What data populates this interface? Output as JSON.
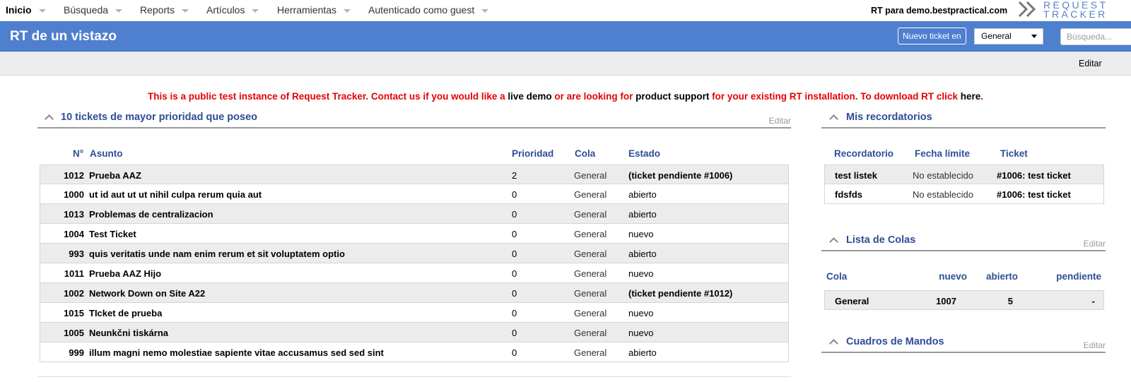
{
  "nav": {
    "items": [
      {
        "label": "Inicio",
        "active": true
      },
      {
        "label": "Búsqueda"
      },
      {
        "label": "Reports"
      },
      {
        "label": "Artículos"
      },
      {
        "label": "Herramientas"
      },
      {
        "label": "Autenticado como guest"
      }
    ],
    "rt_for": "RT para demo.bestpractical.com",
    "logo_line1": "REQUEST",
    "logo_line2": "TRACKER"
  },
  "header": {
    "title": "RT de un vistazo",
    "new_ticket_label": "Nuevo ticket en",
    "queue_selected": "General",
    "search_placeholder": "Búsqueda..."
  },
  "subbar": {
    "edit_label": "Editar"
  },
  "notice": {
    "part1": "This is a public test instance of Request Tracker. Contact us if you would like a ",
    "link1": "live demo",
    "part2": " or are looking for ",
    "link2": "product support",
    "part3": " for your existing RT installation. To download RT click ",
    "link3": "here",
    "part4": "."
  },
  "tickets_widget": {
    "title": "10 tickets de mayor prioridad que poseo",
    "edit_label": "Editar",
    "columns": {
      "id": "N°",
      "subject": "Asunto",
      "priority": "Prioridad",
      "queue": "Cola",
      "status": "Estado"
    },
    "rows": [
      {
        "id": "1012",
        "subject": "Prueba AAZ",
        "priority": "2",
        "queue": "General",
        "status": "(ticket pendiente #1006)",
        "status_bold": true
      },
      {
        "id": "1000",
        "subject": "ut id aut ut ut nihil culpa rerum quia aut",
        "priority": "0",
        "queue": "General",
        "status": "abierto"
      },
      {
        "id": "1013",
        "subject": "Problemas de centralizacion",
        "priority": "0",
        "queue": "General",
        "status": "abierto"
      },
      {
        "id": "1004",
        "subject": "Test Ticket",
        "priority": "0",
        "queue": "General",
        "status": "nuevo"
      },
      {
        "id": "993",
        "subject": "quis veritatis unde nam enim rerum et sit voluptatem optio",
        "priority": "0",
        "queue": "General",
        "status": "abierto"
      },
      {
        "id": "1011",
        "subject": "Prueba AAZ Hijo",
        "priority": "0",
        "queue": "General",
        "status": "nuevo"
      },
      {
        "id": "1002",
        "subject": "Network Down on Site A22",
        "priority": "0",
        "queue": "General",
        "status": "(ticket pendiente #1012)",
        "status_bold": true
      },
      {
        "id": "1015",
        "subject": "TIcket de prueba",
        "priority": "0",
        "queue": "General",
        "status": "nuevo"
      },
      {
        "id": "1005",
        "subject": "Neunkčni tiskárna",
        "priority": "0",
        "queue": "General",
        "status": "nuevo"
      },
      {
        "id": "999",
        "subject": "illum magni nemo molestiae sapiente vitae accusamus sed sed sint",
        "priority": "0",
        "queue": "General",
        "status": "abierto"
      }
    ]
  },
  "reminders_widget": {
    "title": "Mis recordatorios",
    "columns": {
      "reminder": "Recordatorio",
      "due": "Fecha límite",
      "ticket": "Ticket"
    },
    "rows": [
      {
        "reminder": "test listek",
        "due": "No establecido",
        "ticket": "#1006: test ticket"
      },
      {
        "reminder": "fdsfds",
        "due": "No establecido",
        "ticket": "#1006: test ticket"
      }
    ]
  },
  "queues_widget": {
    "title": "Lista de Colas",
    "edit_label": "Editar",
    "columns": {
      "queue": "Cola",
      "new": "nuevo",
      "open": "abierto",
      "pending": "pendiente"
    },
    "rows": [
      {
        "queue": "General",
        "new": "1007",
        "open": "5",
        "pending": "-"
      }
    ]
  },
  "dashboards_widget": {
    "title": "Cuadros de Mandos",
    "edit_label": "Editar"
  }
}
